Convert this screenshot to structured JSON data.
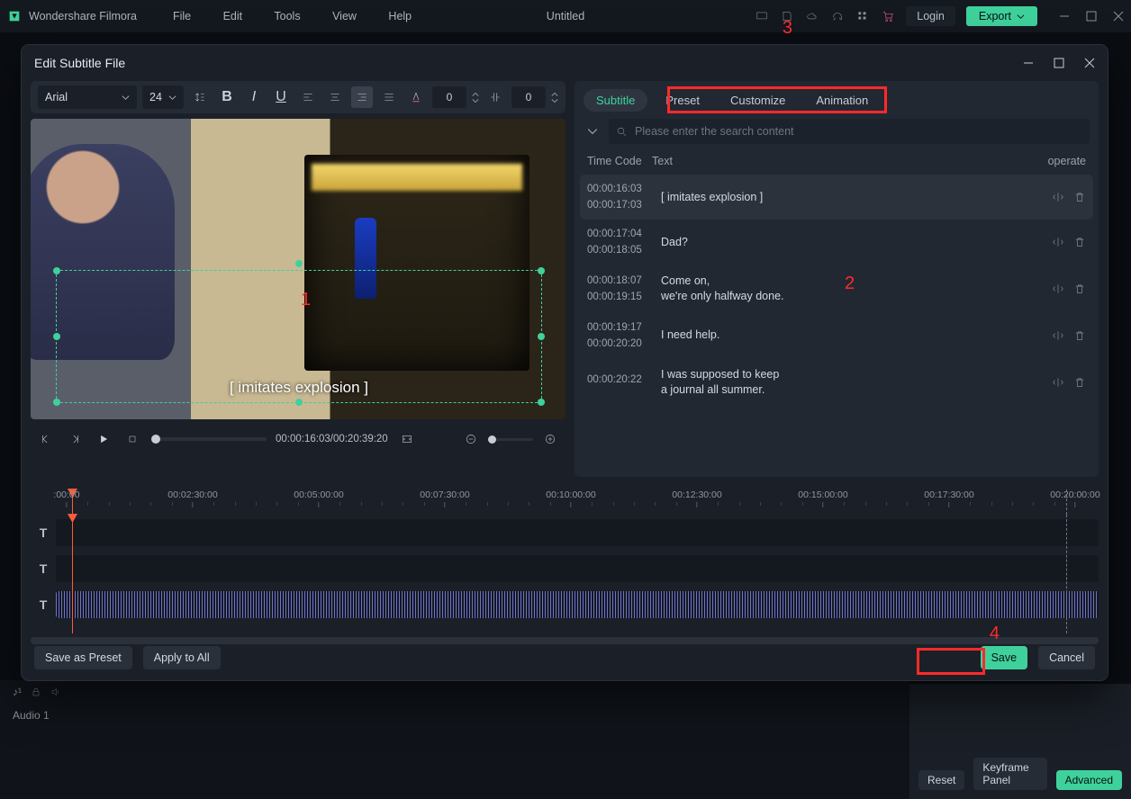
{
  "app": {
    "name": "Wondershare Filmora",
    "menus": [
      "File",
      "Edit",
      "Tools",
      "View",
      "Help"
    ],
    "doc_title": "Untitled",
    "login": "Login",
    "export": "Export"
  },
  "dialog": {
    "title": "Edit Subtitle File"
  },
  "toolbar": {
    "font": "Arial",
    "size": "24",
    "char_spacing": "0",
    "line_spacing": "0"
  },
  "preview": {
    "subtitle_text": "[ imitates explosion ]",
    "time_label": "00:00:16:03/00:20:39:20"
  },
  "tabs": {
    "subtitle": "Subtitle",
    "preset": "Preset",
    "customize": "Customize",
    "animation": "Animation"
  },
  "search": {
    "placeholder": "Please enter the search content"
  },
  "list_head": {
    "timecode": "Time Code",
    "text": "Text",
    "operate": "operate"
  },
  "subtitles": [
    {
      "start": "00:00:16:03",
      "end": "00:00:17:03",
      "text": "[ imitates explosion ]"
    },
    {
      "start": "00:00:17:04",
      "end": "00:00:18:05",
      "text": "Dad?"
    },
    {
      "start": "00:00:18:07",
      "end": "00:00:19:15",
      "text": "Come on,\nwe're only halfway done."
    },
    {
      "start": "00:00:19:17",
      "end": "00:00:20:20",
      "text": "I need help."
    },
    {
      "start": "00:00:20:22",
      "end": "",
      "text": "I was supposed to keep\na journal all summer."
    }
  ],
  "ruler": [
    ":00:00",
    "00:02:30:00",
    "00:05:00:00",
    "00:07:30:00",
    "00:10:00:00",
    "00:12:30:00",
    "00:15:00:00",
    "00:17:30:00",
    "00:20:00:00"
  ],
  "buttons": {
    "save_preset": "Save as Preset",
    "apply_all": "Apply to All",
    "save": "Save",
    "cancel": "Cancel"
  },
  "bg_panel": {
    "reset": "Reset",
    "keyframe": "Keyframe Panel",
    "advanced": "Advanced"
  },
  "bg_bottom": {
    "audio_label": "Audio 1"
  },
  "markers": {
    "m1": "1",
    "m2": "2",
    "m3": "3",
    "m4": "4"
  }
}
